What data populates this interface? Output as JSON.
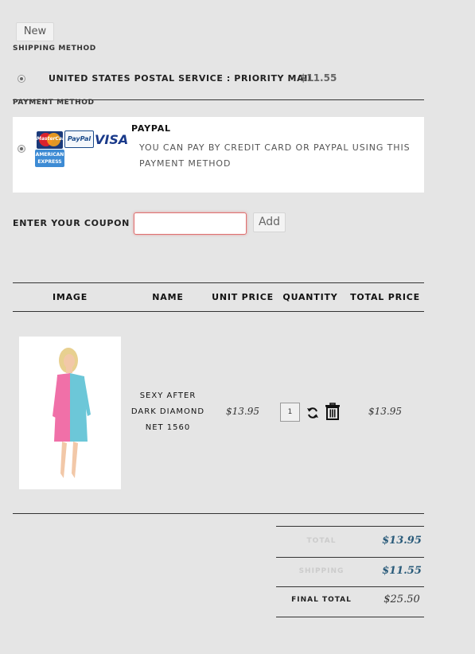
{
  "new_button": "New",
  "shipping": {
    "label": "SHIPPING METHOD",
    "option": "UNITED STATES POSTAL SERVICE : PRIORITY MAIL",
    "price": "$11.55"
  },
  "payment": {
    "label": "PAYMENT METHOD",
    "title": "PAYPAL",
    "description": "YOU CAN PAY BY CREDIT CARD OR PAYPAL USING THIS PAYMENT METHOD",
    "logos": {
      "mastercard": "MasterCard",
      "paypal": "PayPal",
      "visa": "VISA",
      "amex_line1": "AMERICAN",
      "amex_line2": "EXPRESS"
    }
  },
  "coupon": {
    "label": "ENTER YOUR COUPON",
    "value": "",
    "add_label": "Add"
  },
  "cart": {
    "headers": [
      "IMAGE",
      "NAME",
      "UNIT PRICE",
      "QUANTITY",
      "TOTAL PRICE"
    ],
    "item": {
      "name_line1": "SEXY AFTER",
      "name_line2": "DARK DIAMOND",
      "name_line3": "NET 1560",
      "unit_price": "$13.95",
      "quantity": "1",
      "total_price": "$13.95"
    }
  },
  "totals": {
    "total_label": "TOTAL",
    "total_value": "$13.95",
    "shipping_label": "SHIPPING",
    "shipping_value": "$11.55",
    "final_label": "FINAL TOTAL",
    "final_value": "$25.50"
  },
  "colors": {
    "background": "#e5e5e5",
    "price_accent": "#2a5b7a",
    "coupon_border": "#e07070"
  }
}
